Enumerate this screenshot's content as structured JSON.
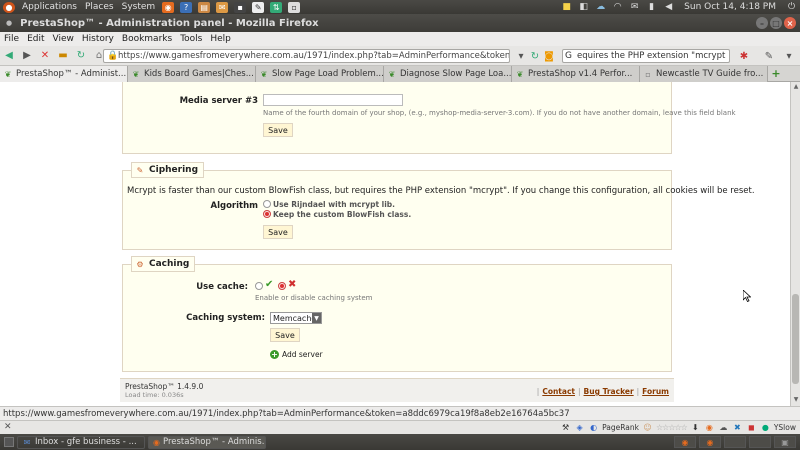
{
  "top_panel": {
    "menus": [
      "Applications",
      "Places",
      "System"
    ],
    "clock": "Sun Oct 14,  4:18 PM"
  },
  "window": {
    "title": "PrestaShop™ - Administration panel - Mozilla Firefox"
  },
  "menubar": [
    "File",
    "Edit",
    "View",
    "History",
    "Bookmarks",
    "Tools",
    "Help"
  ],
  "navbar": {
    "url": "https://www.gamesfromeverywhere.com.au/1971/index.php?tab=AdminPerformance&token=",
    "search_value": "equires the PHP extension \"mcrypt"
  },
  "tabs": [
    {
      "label": "PrestaShop™ - Administ...",
      "icon": "prestashop-favicon",
      "active": true
    },
    {
      "label": "Kids Board Games|Ches...",
      "icon": "prestashop-favicon",
      "active": false
    },
    {
      "label": "Slow Page Load Problem...",
      "icon": "prestashop-favicon",
      "active": false
    },
    {
      "label": "Diagnose Slow Page Loa...",
      "icon": "prestashop-favicon",
      "active": false
    },
    {
      "label": "PrestaShop v1.4 Perfor...",
      "icon": "prestashop-favicon",
      "active": false
    },
    {
      "label": "Newcastle TV Guide fro...",
      "icon": "page-favicon",
      "active": false
    }
  ],
  "media_server": {
    "label": "Media server #3",
    "value": "",
    "hint": "Name of the fourth domain of your shop, (e.g., myshop-media-server-3.com). If you do not have another domain, leave this field blank",
    "save_label": "Save"
  },
  "ciphering": {
    "legend": "Ciphering",
    "description": "Mcrypt is faster than our custom BlowFish class, but requires the PHP extension \"mcrypt\". If you change this configuration, all cookies will be reset.",
    "algorithm_label": "Algorithm",
    "options": [
      "Use Rijndael with mcrypt lib.",
      "Keep the custom BlowFish class."
    ],
    "selected_index": 1,
    "save_label": "Save"
  },
  "caching": {
    "legend": "Caching",
    "use_cache_label": "Use cache:",
    "use_cache_value": "no",
    "use_cache_hint": "Enable or disable caching system",
    "system_label": "Caching system:",
    "system_value": "Memcached",
    "save_label": "Save",
    "add_server_label": "Add server"
  },
  "footer": {
    "version": "PrestaShop™ 1.4.9.0",
    "load_time": "Load time: 0.036s",
    "links": [
      "Contact",
      "Bug Tracker",
      "Forum"
    ]
  },
  "statusbar": {
    "text": "https://www.gamesfromeverywhere.com.au/1971/index.php?tab=AdminPerformance&token=a8ddc6979ca19f8a8eb2e16764a5bc37"
  },
  "addonbar": {
    "pagerank_label": "PageRank",
    "yslow_label": "YSlow"
  },
  "taskbar": {
    "items": [
      {
        "label": "Inbox - gfe business - ...",
        "icon": "thunderbird-icon",
        "active": false
      },
      {
        "label": "PrestaShop™ - Adminis...",
        "icon": "firefox-icon",
        "active": true
      }
    ]
  },
  "colors": {
    "fieldset_bg": "#fffff0",
    "fieldset_border": "#dfd5c3",
    "link": "#8a3a00",
    "radio_selected": "#d33333",
    "check_green": "#3a9a2a",
    "cross_red": "#d03030"
  }
}
